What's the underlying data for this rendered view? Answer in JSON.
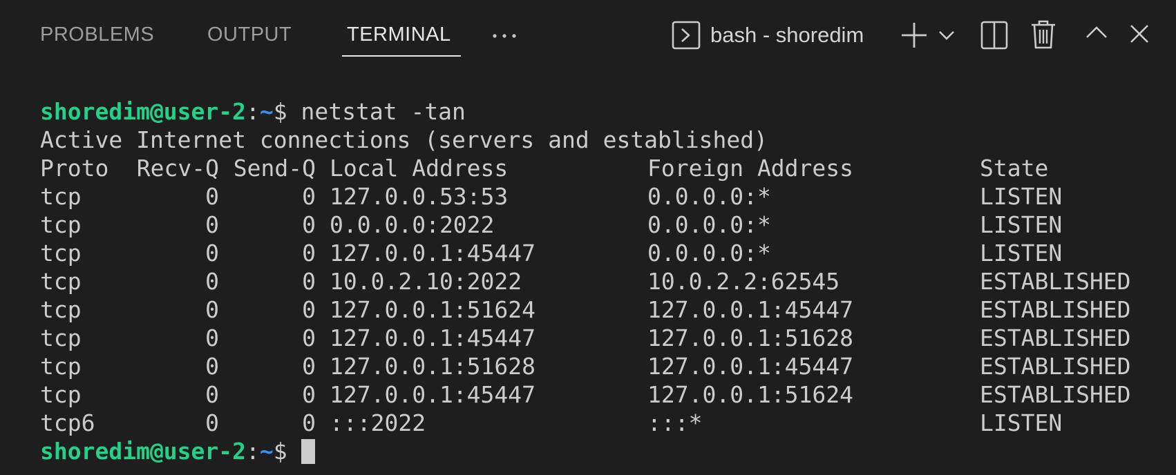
{
  "tabs": [
    {
      "label": "PROBLEMS",
      "active": false
    },
    {
      "label": "OUTPUT",
      "active": false
    },
    {
      "label": "TERMINAL",
      "active": true
    }
  ],
  "toolbar": {
    "more_icon": "ellipsis-icon",
    "terminal_icon": "terminal-icon",
    "terminal_name": "bash - shoredim",
    "icons": [
      "plus-icon",
      "chevron-down-icon",
      "split-icon",
      "trash-icon",
      "chevron-up-icon",
      "close-icon"
    ]
  },
  "prompt": {
    "user_host": "shoredim@user-2",
    "colon": ":",
    "path": "~",
    "symbol": "$"
  },
  "command": " netstat -tan",
  "output_title": "Active Internet connections (servers and established)",
  "table": {
    "headers": [
      "Proto",
      "Recv-Q",
      "Send-Q",
      "Local Address",
      "Foreign Address",
      "State"
    ],
    "rows": [
      [
        "tcp",
        "0",
        "0",
        "127.0.0.53:53",
        "0.0.0.0:*",
        "LISTEN"
      ],
      [
        "tcp",
        "0",
        "0",
        "0.0.0.0:2022",
        "0.0.0.0:*",
        "LISTEN"
      ],
      [
        "tcp",
        "0",
        "0",
        "127.0.0.1:45447",
        "0.0.0.0:*",
        "LISTEN"
      ],
      [
        "tcp",
        "0",
        "0",
        "10.0.2.10:2022",
        "10.0.2.2:62545",
        "ESTABLISHED"
      ],
      [
        "tcp",
        "0",
        "0",
        "127.0.0.1:51624",
        "127.0.0.1:45447",
        "ESTABLISHED"
      ],
      [
        "tcp",
        "0",
        "0",
        "127.0.0.1:45447",
        "127.0.0.1:51628",
        "ESTABLISHED"
      ],
      [
        "tcp",
        "0",
        "0",
        "127.0.0.1:51628",
        "127.0.0.1:45447",
        "ESTABLISHED"
      ],
      [
        "tcp",
        "0",
        "0",
        "127.0.0.1:45447",
        "127.0.0.1:51624",
        "ESTABLISHED"
      ],
      [
        "tcp6",
        "0",
        "0",
        ":::2022",
        ":::*",
        "LISTEN"
      ]
    ]
  },
  "colors": {
    "background": "#1e1e1e",
    "prompt_user": "#23d18b",
    "prompt_path": "#3b8eea",
    "text": "#cccccc"
  }
}
